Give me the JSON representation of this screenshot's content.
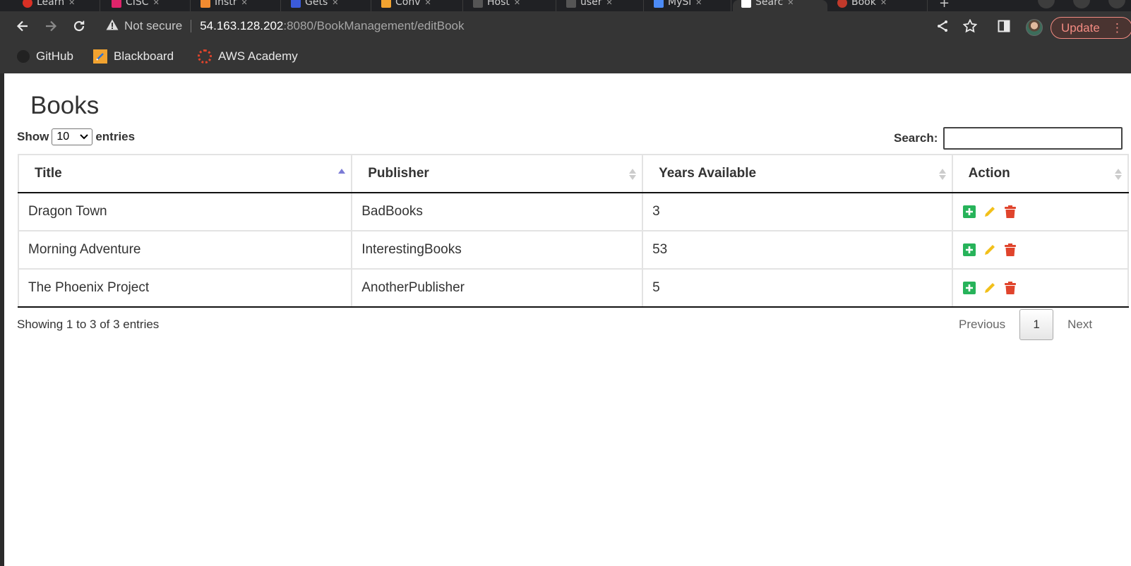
{
  "browser": {
    "tabs": [
      {
        "label": "Learn",
        "favicon_color": "#d93025",
        "active": false
      },
      {
        "label": "CISC",
        "favicon_color": "#e0246b",
        "active": false
      },
      {
        "label": "Instr",
        "favicon_color": "#f28b30",
        "active": false
      },
      {
        "label": "Gets",
        "favicon_color": "#3b5bdb",
        "active": false
      },
      {
        "label": "Conv",
        "favicon_color": "#f2a330",
        "active": false
      },
      {
        "label": "Host",
        "favicon_color": "#555555",
        "active": false
      },
      {
        "label": "user",
        "favicon_color": "#555555",
        "active": false
      },
      {
        "label": "MySl",
        "favicon_color": "#4c8bf5",
        "active": false
      },
      {
        "label": "Searc",
        "favicon_color": "#ffffff",
        "active": true
      },
      {
        "label": "Book",
        "favicon_color": "#c0392b",
        "active": false
      }
    ],
    "address": {
      "security_label": "Not secure",
      "host": "54.163.128.202",
      "path": ":8080/BookManagement/editBook"
    },
    "update_label": "Update",
    "bookmarks": [
      {
        "label": "GitHub",
        "icon": "github-icon",
        "color": "#222222"
      },
      {
        "label": "Blackboard",
        "icon": "blackboard-icon",
        "color": "#f2a330"
      },
      {
        "label": "AWS Academy",
        "icon": "aws-academy-icon",
        "color": "#e0442c"
      }
    ]
  },
  "page": {
    "title": "Books",
    "length": {
      "show_label": "Show",
      "value": "10",
      "entries_label": "entries"
    },
    "search": {
      "label": "Search:",
      "value": "",
      "placeholder": ""
    },
    "table": {
      "columns": [
        {
          "label": "Title",
          "sort": "ascending"
        },
        {
          "label": "Publisher",
          "sort": "none"
        },
        {
          "label": "Years Available",
          "sort": "none"
        },
        {
          "label": "Action",
          "sort": "none"
        }
      ],
      "rows": [
        {
          "title": "Dragon Town",
          "publisher": "BadBooks",
          "years": "3"
        },
        {
          "title": "Morning Adventure",
          "publisher": "InterestingBooks",
          "years": "53"
        },
        {
          "title": "The Phoenix Project",
          "publisher": "AnotherPublisher",
          "years": "5"
        }
      ],
      "action_icons": [
        "add-icon",
        "edit-icon",
        "delete-icon"
      ],
      "action_colors": {
        "add": "#27b35a",
        "edit": "#f2c01a",
        "delete": "#e0442c"
      }
    },
    "info": "Showing 1 to 3 of 3 entries",
    "pagination": {
      "previous": "Previous",
      "current": "1",
      "next": "Next"
    }
  }
}
